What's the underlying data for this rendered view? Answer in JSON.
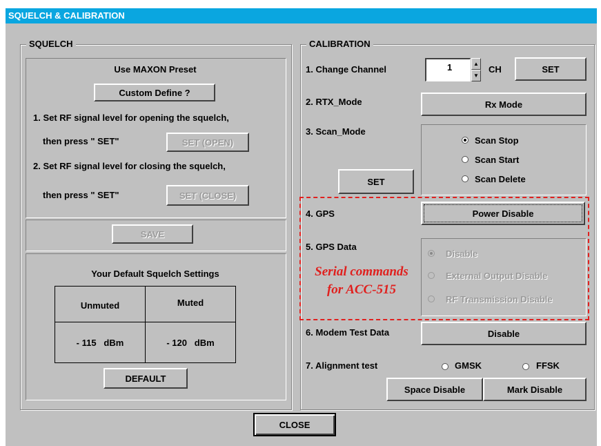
{
  "window": {
    "title": "SQUELCH & CALIBRATION"
  },
  "squelch": {
    "legend": "SQUELCH",
    "preset_title": "Use MAXON Preset",
    "custom_define": "Custom Define ?",
    "step1": "1. Set RF signal level for opening the squelch,",
    "then_press_1": "then press  \" SET\"",
    "set_open": "SET (OPEN)",
    "step2": "2. Set RF signal level for closing the squelch,",
    "then_press_2": "then press  \" SET\"",
    "set_close": "SET (CLOSE)",
    "save": "SAVE",
    "default_title": "Your Default Squelch Settings",
    "col_unmuted": "Unmuted",
    "col_muted": "Muted",
    "unmuted_value": "- 115   dBm",
    "muted_value": "- 120   dBm",
    "default_button": "DEFAULT"
  },
  "calibration": {
    "legend": "CALIBRATION",
    "change_channel_label": "1. Change Channel",
    "channel_value": "1",
    "ch_label": "CH",
    "set_channel": "SET",
    "rtx_label": "2. RTX_Mode",
    "rtx_button": "Rx Mode",
    "scan_label": "3. Scan_Mode",
    "scan_set": "SET",
    "scan_options": [
      "Scan Stop",
      "Scan Start",
      "Scan Delete"
    ],
    "scan_selected": "Scan Stop",
    "gps_label": "4. GPS",
    "gps_button": "Power Disable",
    "gps_data_label": "5. GPS Data",
    "gps_data_options": [
      "Disable",
      "External Output Disable",
      "RF Transmission Disable"
    ],
    "gps_data_selected": "Disable",
    "annotation_line1": "Serial commands",
    "annotation_line2": "for ACC-515",
    "modem_label": "6. Modem Test Data",
    "modem_button": "Disable",
    "alignment_label": "7. Alignment test",
    "alignment_options": [
      "GMSK",
      "FFSK"
    ],
    "space_button": "Space Disable",
    "mark_button": "Mark Disable"
  },
  "footer": {
    "close": "CLOSE"
  },
  "colors": {
    "title_bar": "#0aa6e0",
    "window_bg": "#c0c0c0",
    "annotation": "#e0201e"
  }
}
